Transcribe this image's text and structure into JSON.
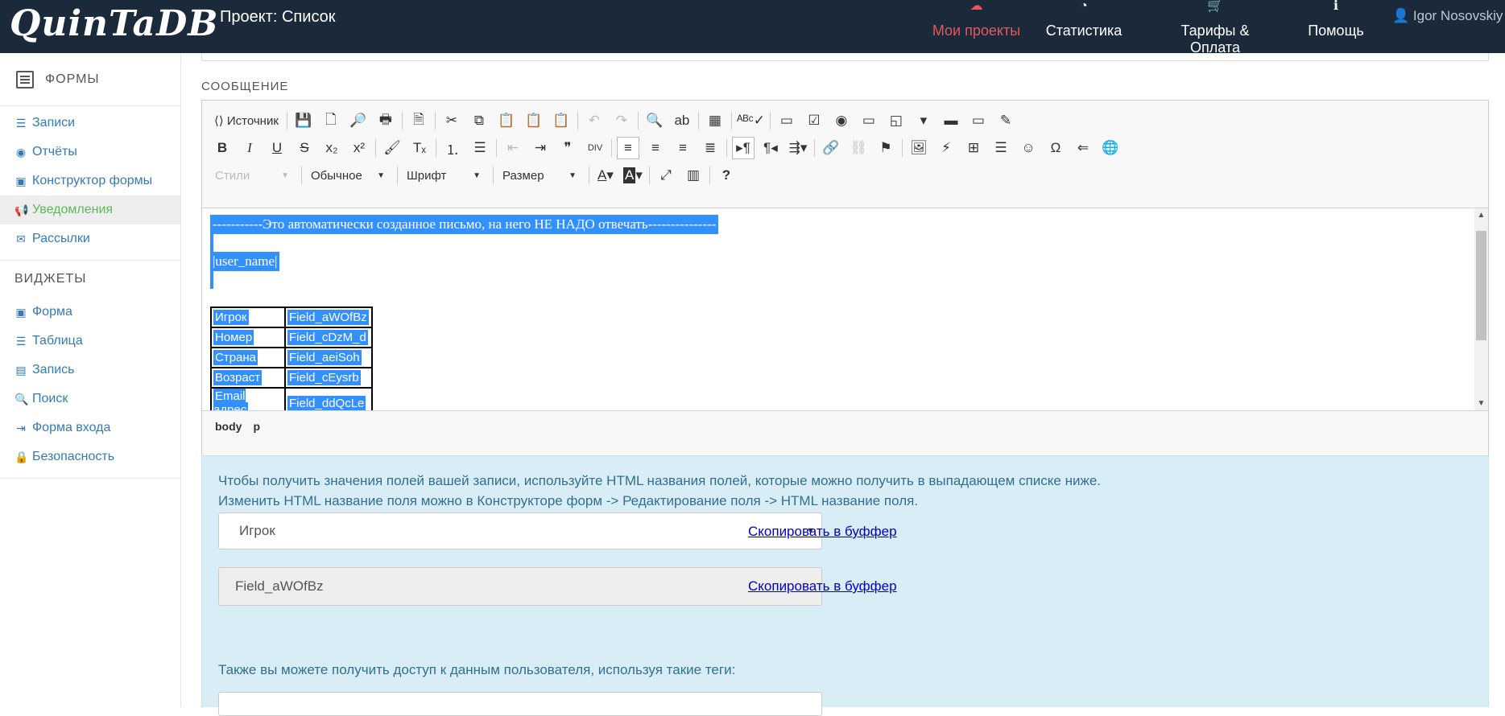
{
  "header": {
    "logo": "QuinTaDB",
    "project_title": "Проект: Список",
    "nav": [
      {
        "label": "Мои проекты",
        "icon": "cloud-icon"
      },
      {
        "label": "Статистика",
        "icon": "pie-chart-icon"
      },
      {
        "label": "Тарифы & Оплата",
        "icon": "cart-icon"
      },
      {
        "label": "Помощь",
        "icon": "info-icon"
      }
    ],
    "user": "Igor Nosovskiy",
    "active_color": "#e8555b"
  },
  "sidebar": {
    "forms_header": "ФОРМЫ",
    "items": [
      {
        "label": "Записи",
        "icon": "list-icon"
      },
      {
        "label": "Отчёты",
        "icon": "target-icon"
      },
      {
        "label": "Конструктор формы",
        "icon": "form-icon"
      },
      {
        "label": "Уведомления",
        "icon": "megaphone-icon"
      },
      {
        "label": "Рассылки",
        "icon": "envelope-icon"
      }
    ],
    "widgets_header": "ВИДЖЕТЫ",
    "widgets": [
      {
        "label": "Форма",
        "icon": "form-icon"
      },
      {
        "label": "Таблица",
        "icon": "list-icon"
      },
      {
        "label": "Запись",
        "icon": "record-icon"
      },
      {
        "label": "Поиск",
        "icon": "search-icon"
      },
      {
        "label": "Форма входа",
        "icon": "login-icon"
      },
      {
        "label": "Безопасность",
        "icon": "lock-icon"
      }
    ],
    "active_color": "#5cb85c"
  },
  "main": {
    "message_label": "СООБЩЕНИЕ",
    "editor": {
      "source_label": "Источник",
      "styles_combo": "Стили",
      "format_combo": "Обычное",
      "font_combo": "Шрифт",
      "size_combo": "Размер",
      "content": {
        "line1": "-----------Это автоматически созданное письмо, на него НЕ НАДО отвечать---------------",
        "user_tag": "|user_name|",
        "table": [
          [
            "Игрок",
            "Field_aWOfBz"
          ],
          [
            "Номер",
            "Field_cDzM_d"
          ],
          [
            "Страна",
            "Field_aeiSoh"
          ],
          [
            "Возраст",
            "Field_cEysrb"
          ],
          [
            "Email адрес",
            "Field_ddQcLe"
          ]
        ]
      },
      "path": [
        "body",
        "p"
      ]
    },
    "info": {
      "line1": "Чтобы получить значения полей вашей записи, используйте HTML названия полей, которые можно получить в выпадающем списке ниже.",
      "line2": "Изменить HTML название поля можно в Конструкторе форм -> Редактирование поля -> HTML название поля.",
      "select_value": "Игрок",
      "field_value": "Field_aWOfBz",
      "copy_label": "Скопировать в буффер",
      "also_text": "Также вы можете получить доступ к данным пользователя, используя такие теги:"
    }
  }
}
